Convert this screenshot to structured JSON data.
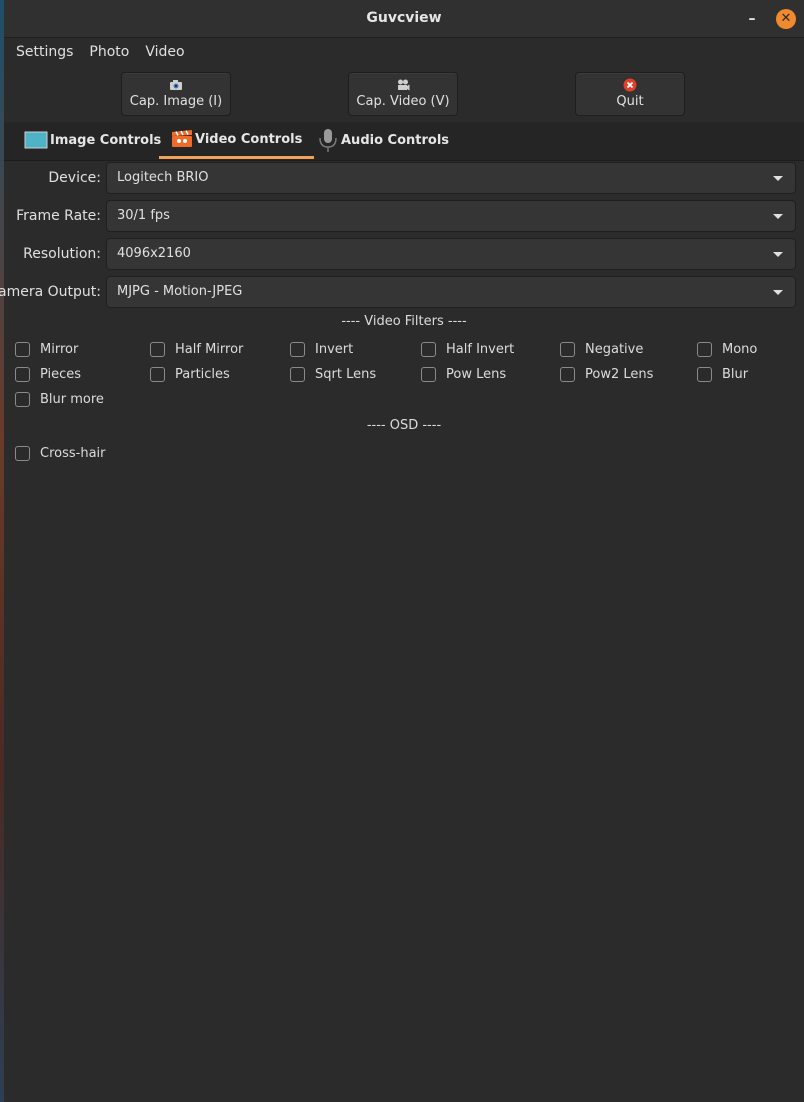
{
  "window": {
    "title": "Guvcview",
    "minimize_glyph": "–",
    "close_glyph": "✕"
  },
  "menubar": [
    "Settings",
    "Photo",
    "Video"
  ],
  "toolbar": {
    "cap_image": {
      "label": "Cap. Image (I)",
      "icon": "camera-icon"
    },
    "cap_video": {
      "label": "Cap. Video (V)",
      "icon": "video-camera-icon"
    },
    "quit": {
      "label": "Quit",
      "icon": "quit-icon",
      "icon_color": "#e0402a"
    }
  },
  "tabs": [
    {
      "label": "Image Controls",
      "icon": "image-icon",
      "active": false
    },
    {
      "label": "Video Controls",
      "icon": "clapperboard-icon",
      "active": true
    },
    {
      "label": "Audio Controls",
      "icon": "microphone-icon",
      "active": false
    }
  ],
  "video_controls": {
    "device": {
      "label": "Device:",
      "value": "Logitech BRIO"
    },
    "frame_rate": {
      "label": "Frame Rate:",
      "value": "30/1 fps"
    },
    "resolution": {
      "label": "Resolution:",
      "value": "4096x2160"
    },
    "camera_output": {
      "label": "Camera Output:",
      "value": "MJPG - Motion-JPEG"
    }
  },
  "video_filters": {
    "title": "---- Video Filters ----",
    "items": [
      "Mirror",
      "Half Mirror",
      "Invert",
      "Half Invert",
      "Negative",
      "Mono",
      "Pieces",
      "Particles",
      "Sqrt Lens",
      "Pow Lens",
      "Pow2 Lens",
      "Blur",
      "Blur more"
    ]
  },
  "osd": {
    "title": "---- OSD ----",
    "items": [
      "Cross-hair"
    ]
  },
  "colors": {
    "accent": "#f0a25a",
    "close_button": "#f08a2c",
    "background": "#2b2b2b"
  }
}
